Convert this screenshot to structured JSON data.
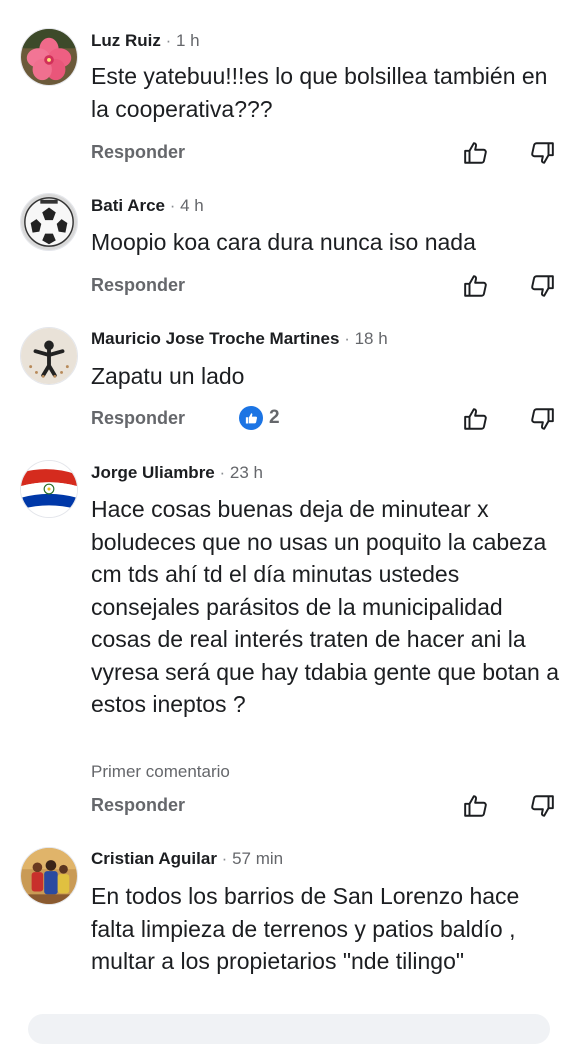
{
  "comments": [
    {
      "author": "Luz Ruiz",
      "time": "1 h",
      "text": "Este yatebuu!!!es lo que bolsillea también en la cooperativa???",
      "reply_label": "Responder",
      "avatar_icon": "pink-flower-icon"
    },
    {
      "author": "Bati Arce",
      "time": "4 h",
      "text": "Moopio koa cara dura nunca iso nada",
      "reply_label": "Responder",
      "avatar_icon": "soccer-ball-icon"
    },
    {
      "author": "Mauricio Jose Troche Martines",
      "time": "18 h",
      "text": "Zapatu un lado",
      "reply_label": "Responder",
      "reactions": "2",
      "avatar_icon": "person-silhouette-icon"
    },
    {
      "author": "Jorge Uliambre",
      "time": "23 h",
      "text": "Hace cosas buenas deja de minutear x boludeces que no usas un poquito la cabeza cm tds ahí td el día minutas ustedes consejales parásitos de la municipalidad cosas de real interés traten de hacer ani la vyresa será que hay tdabia gente que botan a estos ineptos ?",
      "first_comment": "Primer comentario",
      "reply_label": "Responder",
      "avatar_icon": "paraguay-flag-icon"
    },
    {
      "author": "Cristian Aguilar",
      "time": "57 min",
      "text": "En todos los barrios de San Lorenzo hace falta limpieza de terrenos y patios baldío , multar a los propietarios \"nde tilingo\"",
      "avatar_icon": "family-photo-icon"
    }
  ],
  "colors": {
    "text": "#1c1e21",
    "secondary": "#65676b",
    "reaction_blue": "#1b74e4"
  }
}
